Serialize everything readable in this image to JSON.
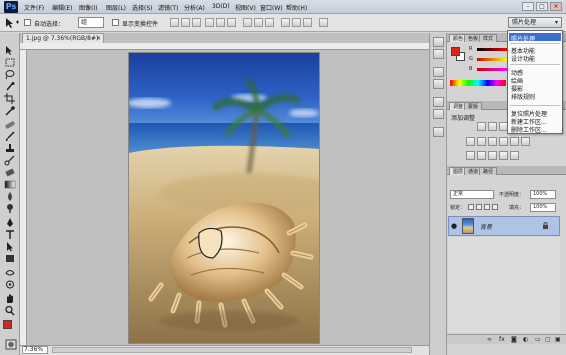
{
  "app": {
    "logo": "Ps",
    "menu": [
      "文件(F)",
      "编辑(E)",
      "图像(I)",
      "图层(L)",
      "选择(S)",
      "滤镜(T)",
      "分析(A)",
      "3D(D)",
      "视图(V)",
      "窗口(W)",
      "帮助(H)"
    ],
    "window_controls": [
      "–",
      "□",
      "×"
    ]
  },
  "options_bar": {
    "auto_select_label": "自动选择：",
    "auto_select_value": "组",
    "show_transform_label": "显示变换控件",
    "workspace_value": "照片处理"
  },
  "workspace_menu": {
    "items": [
      "照片处理",
      "基本功能",
      "设计功能",
      "动感",
      "绘画",
      "摄影",
      "排版规则",
      "复位照片处理",
      "新建工作区...",
      "删除工作区..."
    ],
    "selected": "照片处理"
  },
  "document": {
    "tab_label": "1.jpg @ 7.36%(RGB/8#)",
    "zoom": "7.36%"
  },
  "color_panel": {
    "tabs": [
      "颜色",
      "色板",
      "样式"
    ],
    "channels": [
      "R",
      "G",
      "B"
    ]
  },
  "adjustments_panel": {
    "tabs": [
      "调整",
      "蒙版"
    ],
    "title": "添加调整"
  },
  "layers_panel": {
    "tabs": [
      "图层",
      "通道",
      "路径"
    ],
    "blend_mode": "正常",
    "opacity_label": "不透明度：",
    "opacity_value": "100%",
    "lock_label": "锁定：",
    "fill_label": "填充：",
    "fill_value": "100%",
    "layer_name": "背景"
  },
  "colors": {
    "foreground": "#d9241c",
    "background": "#ffffff",
    "selection": "#3c6fcf"
  }
}
